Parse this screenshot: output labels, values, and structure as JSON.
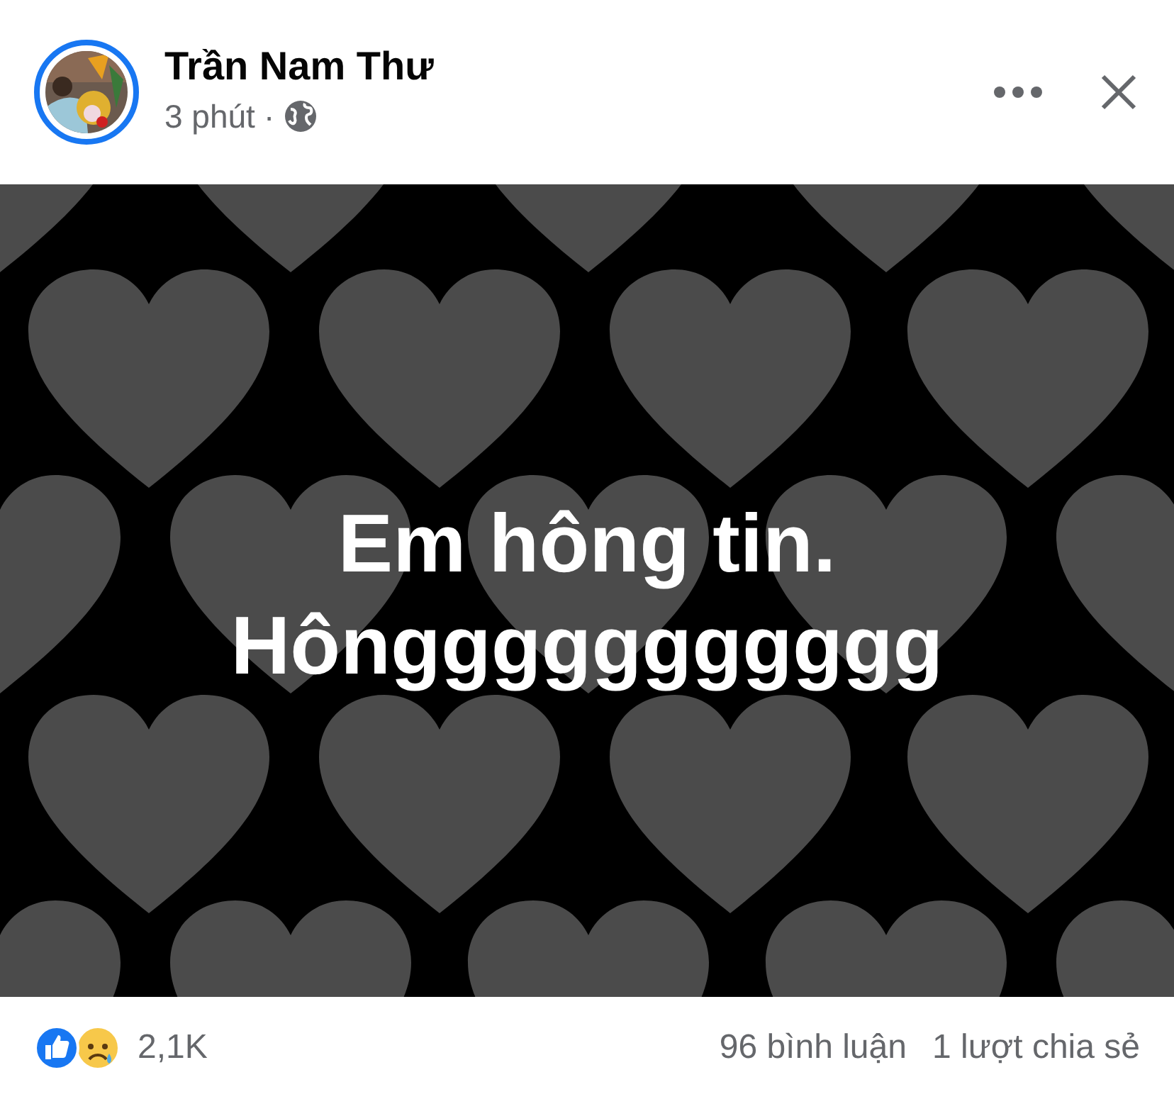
{
  "post": {
    "author": "Trần Nam Thư",
    "time": "3 phút",
    "separator": "·",
    "text_lines": [
      "Em hông tin.",
      "Hônggggggggggg"
    ],
    "reactions": [
      {
        "kind": "like"
      },
      {
        "kind": "sad"
      }
    ],
    "reaction_count": "2,1K",
    "comments": "96 bình luận",
    "shares": "1 lượt chia sẻ"
  }
}
